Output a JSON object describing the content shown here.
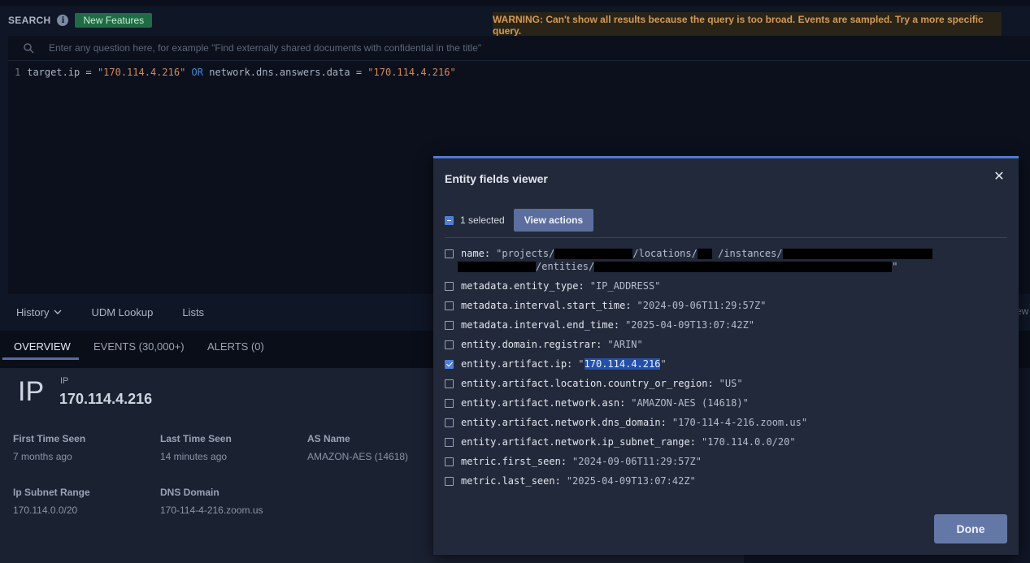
{
  "header": {
    "search_title": "SEARCH",
    "info_icon_glyph": "i",
    "badge_label": "New Features",
    "warning": "WARNING: Can't show all results because the query is too broad. Events are sampled. Try a more specific query."
  },
  "query": {
    "placeholder": "Enter any question here, for example \"Find externally shared documents with confidential in the title\"",
    "line_number": "1",
    "tokens": {
      "field1": "target.ip = ",
      "value1": "\"170.114.4.216\"",
      "op": " OR ",
      "field2": "network.dns.answers.data = ",
      "value2": "\"170.114.4.216\""
    }
  },
  "nav": {
    "history": "History",
    "udm_lookup": "UDM Lookup",
    "lists": "Lists",
    "edge_partial": "ew"
  },
  "tabs": {
    "overview": "OVERVIEW",
    "events": "EVENTS (30,000+)",
    "alerts": "ALERTS (0)"
  },
  "overview": {
    "type_short": "IP",
    "type_label": "IP",
    "ip": "170.114.4.216",
    "fields": [
      {
        "label": "First Time Seen",
        "value": "7 months ago"
      },
      {
        "label": "Last Time Seen",
        "value": "14 minutes ago"
      },
      {
        "label": "AS Name",
        "value": "AMAZON-AES (14618)"
      },
      {
        "label": "Ip Subnet Range",
        "value": "170.114.0.0/20"
      },
      {
        "label": "DNS Domain",
        "value": "170-114-4-216.zoom.us"
      }
    ]
  },
  "modal": {
    "title": "Entity fields viewer",
    "close_glyph": "✕",
    "selected_text": "1 selected",
    "view_actions": "View actions",
    "name_field": {
      "key": "name:",
      "p1": "\"projects/",
      "p2": "/locations/",
      "p3": "/instances/",
      "p4": "/entities/",
      "p5": "\""
    },
    "fields": [
      {
        "key": "metadata.entity_type:",
        "value": "\"IP_ADDRESS\""
      },
      {
        "key": "metadata.interval.start_time:",
        "value": "\"2024-09-06T11:29:57Z\""
      },
      {
        "key": "metadata.interval.end_time:",
        "value": "\"2025-04-09T13:07:42Z\""
      },
      {
        "key": "entity.domain.registrar:",
        "value": "\"ARIN\""
      },
      {
        "key": "entity.artifact.ip:",
        "value_prefix": "\"",
        "value_hl": "170.114.4.216",
        "value_suffix": "\""
      },
      {
        "key": "entity.artifact.location.country_or_region:",
        "value": "\"US\""
      },
      {
        "key": "entity.artifact.network.asn:",
        "value": "\"AMAZON-AES (14618)\""
      },
      {
        "key": "entity.artifact.network.dns_domain:",
        "value": "\"170-114-4-216.zoom.us\""
      },
      {
        "key": "entity.artifact.network.ip_subnet_range:",
        "value": "\"170.114.0.0/20\""
      },
      {
        "key": "metric.first_seen:",
        "value": "\"2024-09-06T11:29:57Z\""
      },
      {
        "key": "metric.last_seen:",
        "value": "\"2025-04-09T13:07:42Z\""
      }
    ],
    "done": "Done"
  }
}
